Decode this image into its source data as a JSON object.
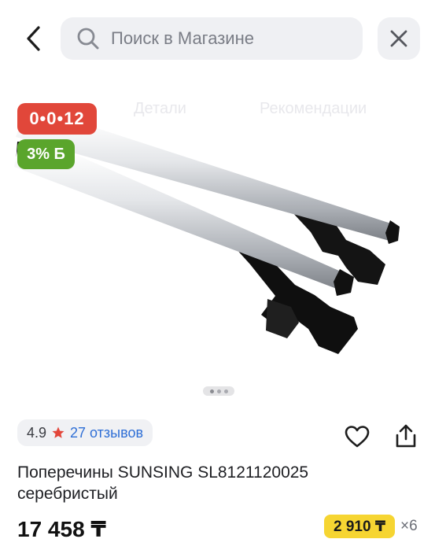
{
  "header": {
    "search_placeholder": "Поиск в Магазине"
  },
  "icons": {
    "back": "chevron-left-icon",
    "search": "search-icon",
    "close": "close-icon",
    "favorite": "heart-icon",
    "share": "share-icon",
    "rating_star": "star-icon"
  },
  "gallery": {
    "ghost_tabs": [
      "Детали",
      "Рекомендации"
    ],
    "timer_badge": "0•0•12",
    "discount_badge": "3% Б",
    "image_alt": "roof-crossbars-product-photo",
    "pages": 3,
    "active_page": 1
  },
  "product": {
    "rating": "4.9",
    "reviews": "27 отзывов",
    "title_line1": "Поперечины SUNSING SL8121120025",
    "title_line2": "серебристый",
    "price": "17 458 ₸",
    "installment": "2 910 ₸",
    "installment_multiplier": "×6"
  },
  "colors": {
    "timer_badge_bg": "#e1473a",
    "discount_badge_bg": "#5aa52c",
    "installment_bg": "#f6d532",
    "star": "#e3463a",
    "reviews_link": "#2f6fd6"
  }
}
